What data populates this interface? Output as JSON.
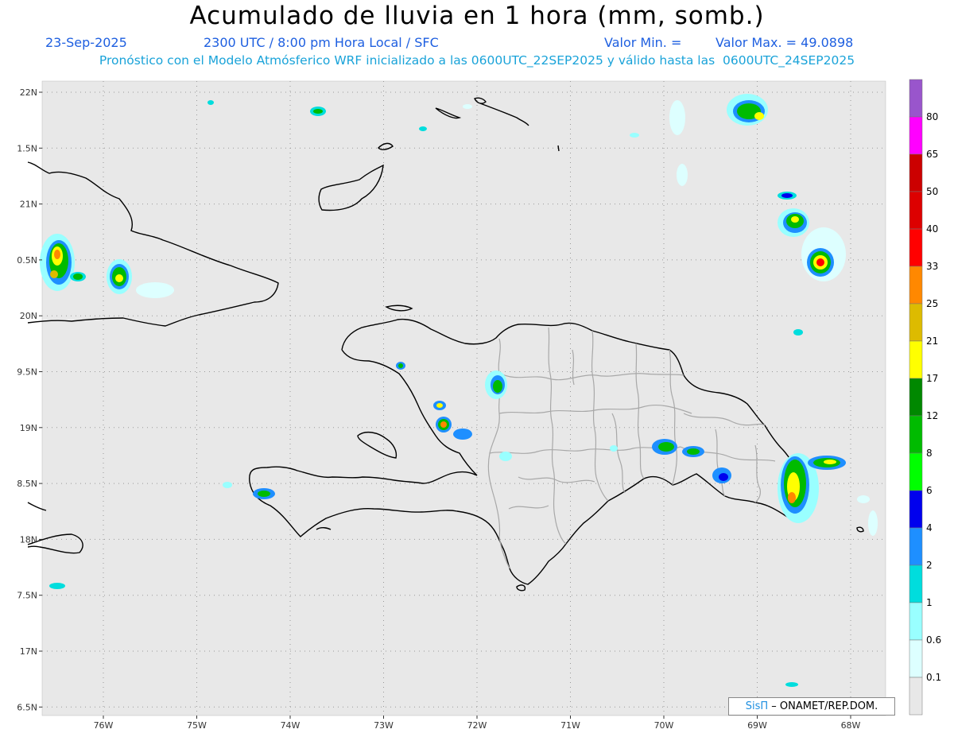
{
  "header": {
    "title": "Acumulado de lluvia en 1 hora (mm, somb.)",
    "date": "23-Sep-2025",
    "time": "2300 UTC / 8:00 pm Hora Local / SFC",
    "min_label": "Valor Min. =",
    "max_label": "Valor Max. = 49.0898",
    "subtitle": "Pronóstico con el Modelo Atmósferico WRF inicializado a las 0600UTC_22SEP2025 y válido hasta las  0600UTC_24SEP2025"
  },
  "axes": {
    "lon_ticks": [
      "76W",
      "75W",
      "74W",
      "73W",
      "72W",
      "71W",
      "70W",
      "69W",
      "68W"
    ],
    "lat_ticks": [
      "22N",
      "1.5N",
      "21N",
      "0.5N",
      "20N",
      "9.5N",
      "19N",
      "8.5N",
      "18N",
      "7.5N",
      "17N",
      "6.5N"
    ]
  },
  "colorbar": {
    "levels": [
      "80",
      "65",
      "50",
      "40",
      "33",
      "25",
      "21",
      "17",
      "12",
      "8",
      "6",
      "4",
      "2",
      "1",
      "0.6",
      "0.1"
    ],
    "colors": [
      "#9955cc",
      "#ff00ff",
      "#cc0000",
      "#dd0000",
      "#ff0000",
      "#ff8800",
      "#ddbb00",
      "#ffff00",
      "#008800",
      "#00bb00",
      "#00ff00",
      "#0000ee",
      "#1e8fff",
      "#00dddd",
      "#99ffff",
      "#ddffff",
      "#e8e8e8"
    ]
  },
  "credit": {
    "brand": "SisΠ",
    "text": "– ONAMET/REP.DOM."
  }
}
